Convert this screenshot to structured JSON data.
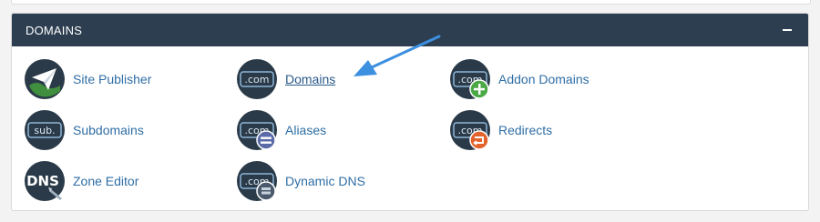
{
  "section": {
    "title": "DOMAINS",
    "collapse_icon": "minus-icon"
  },
  "items": [
    {
      "label": "Site Publisher",
      "icon": "paper-plane-globe-icon"
    },
    {
      "label": "Domains",
      "icon": "dotcom-icon"
    },
    {
      "label": "Addon Domains",
      "icon": "dotcom-plus-icon"
    },
    {
      "label": "Subdomains",
      "icon": "sub-icon",
      "badge_text": "sub."
    },
    {
      "label": "Aliases",
      "icon": "dotcom-equals-icon"
    },
    {
      "label": "Redirects",
      "icon": "dotcom-redirect-icon"
    },
    {
      "label": "Zone Editor",
      "icon": "dns-icon",
      "badge_text": "DNS"
    },
    {
      "label": "Dynamic DNS",
      "icon": "dotcom-dns-icon"
    }
  ],
  "icon_text": ".com",
  "colors": {
    "header_bg": "#2d3e50",
    "icon_bg": "#2a3a48",
    "link": "#2f6ea5",
    "arrow": "#3d8fe0",
    "plus_badge": "#4aa845",
    "equals_badge": "#5b6ba8",
    "redirect_badge": "#e2632b"
  }
}
